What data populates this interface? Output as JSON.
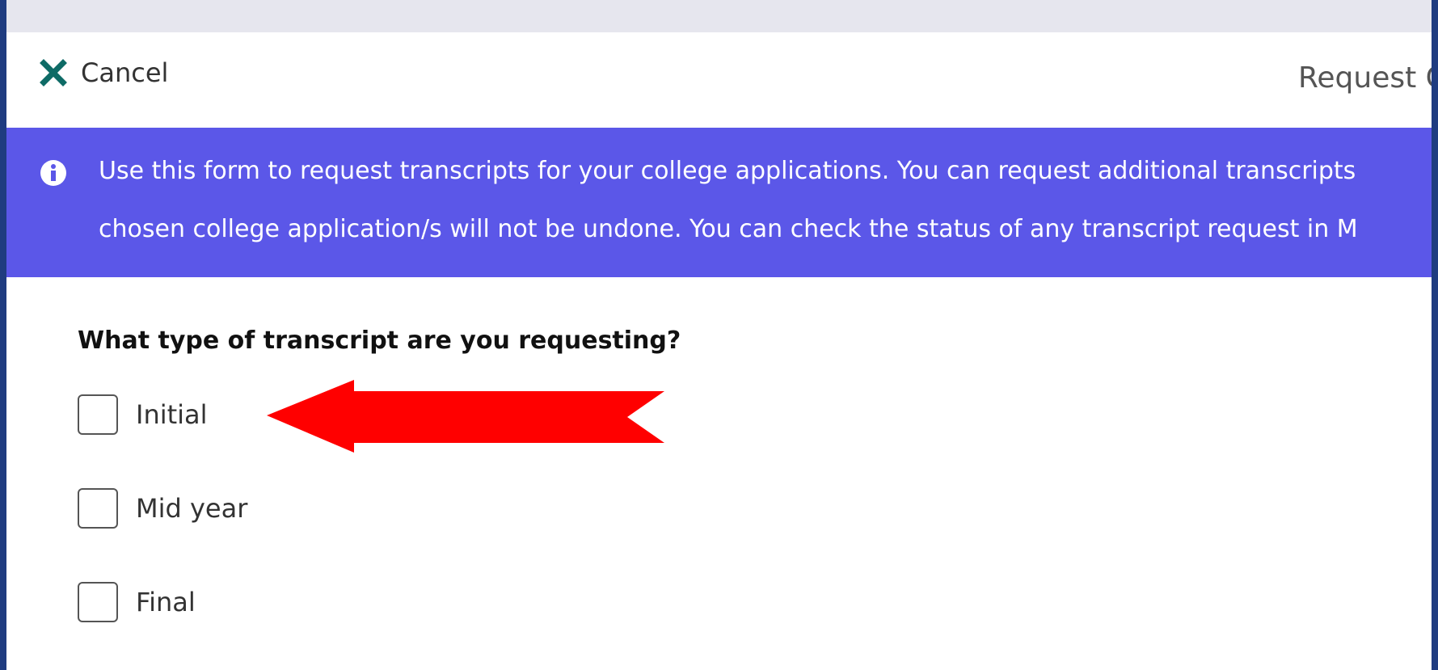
{
  "header": {
    "cancel_label": "Cancel",
    "title": "Request C"
  },
  "banner": {
    "line1": "Use this form to request transcripts for your college applications. You can request additional transcripts",
    "line2": "chosen college application/s will not be undone. You can check the status of any transcript request in M"
  },
  "form": {
    "question": "What type of transcript are you requesting?",
    "options": [
      {
        "label": "Initial",
        "checked": false
      },
      {
        "label": "Mid year",
        "checked": false
      },
      {
        "label": "Final",
        "checked": false
      }
    ]
  },
  "colors": {
    "banner_bg": "#5b57e8",
    "cancel_icon": "#0e6b66",
    "annotation_arrow": "#ff0000",
    "outer_border": "#1f3c80"
  },
  "icons": {
    "cancel": "close-icon",
    "banner": "info-icon"
  }
}
